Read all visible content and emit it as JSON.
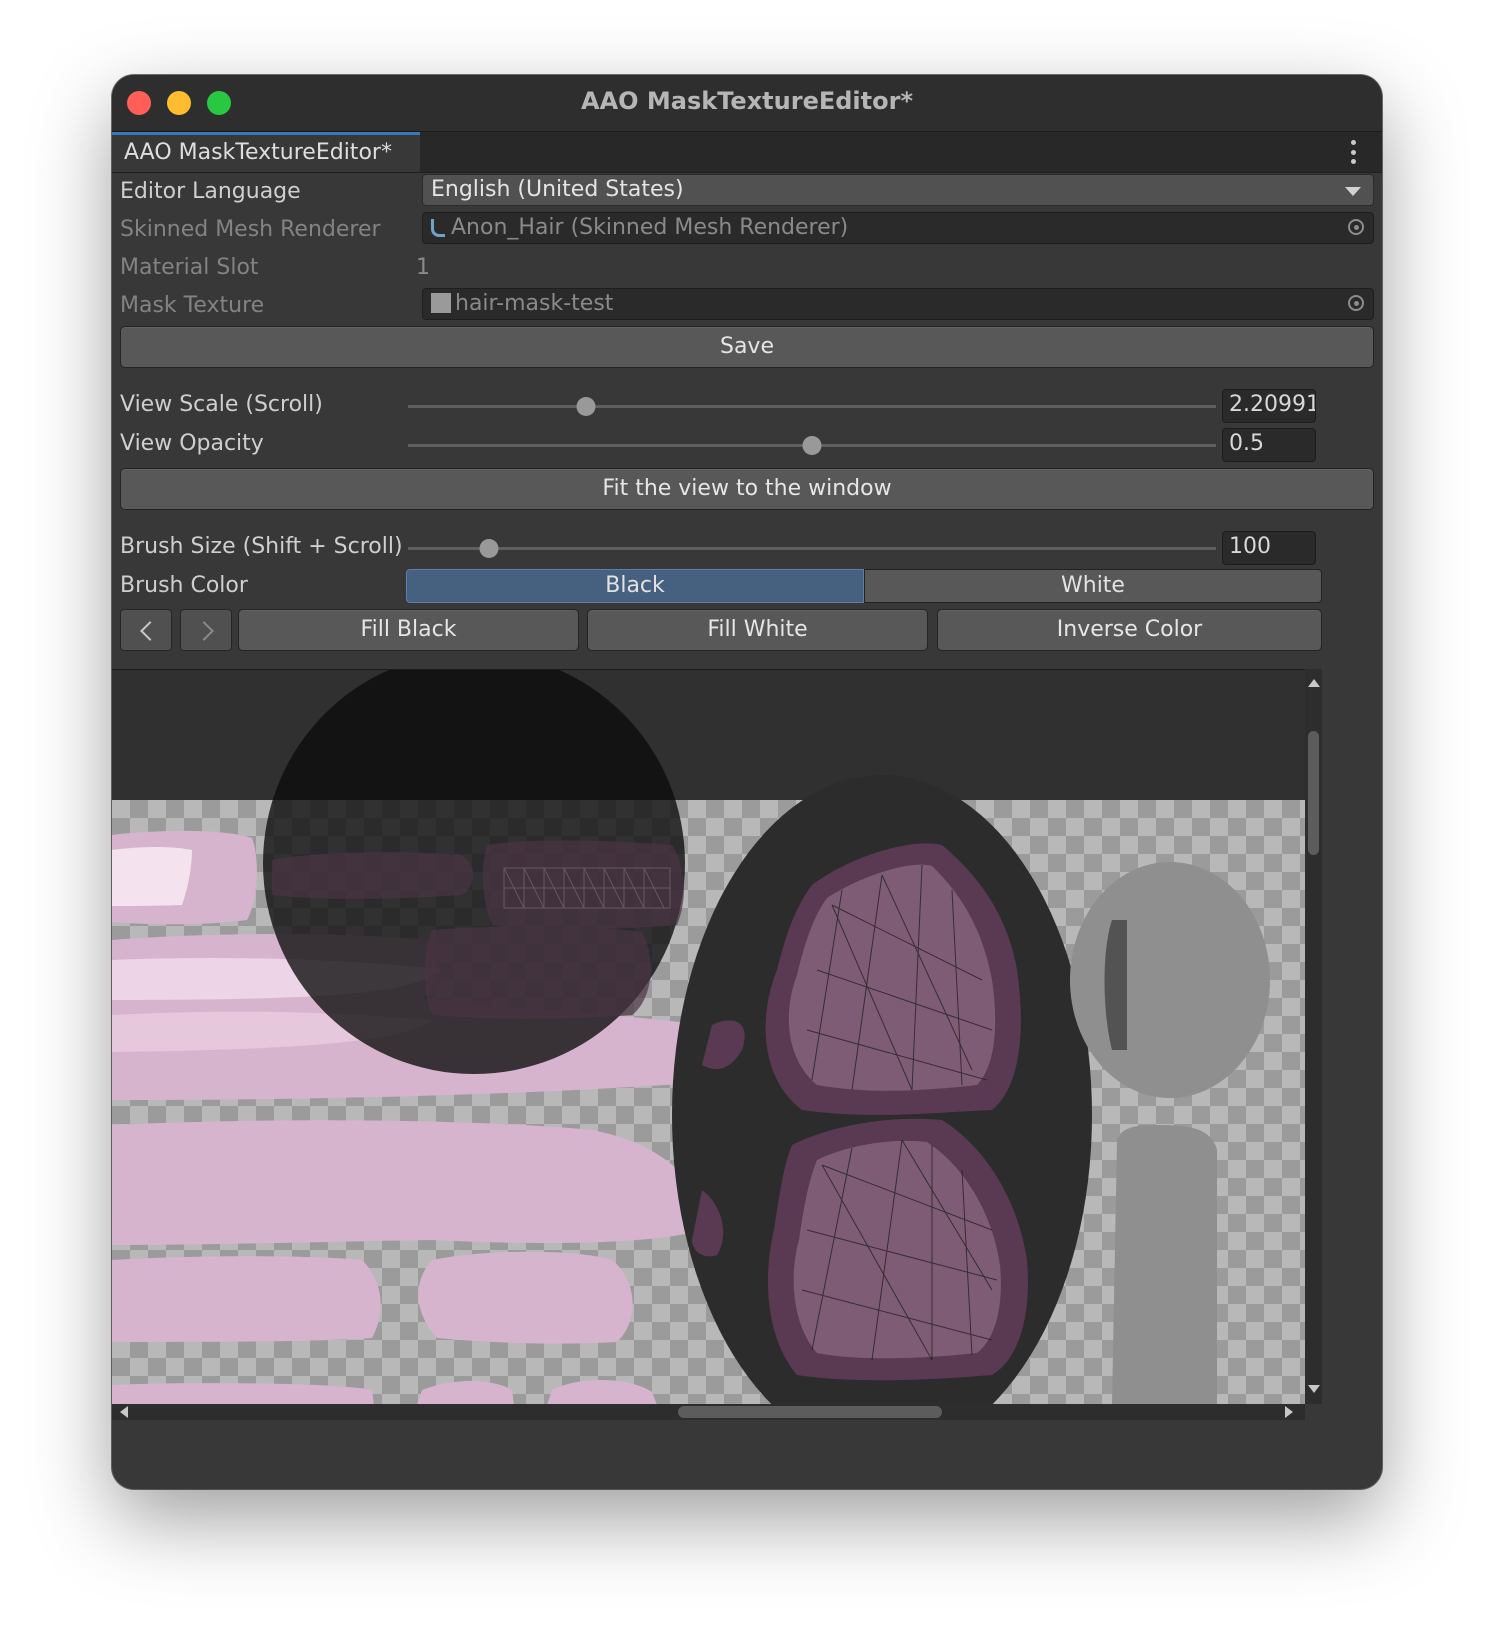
{
  "window": {
    "title": "AAO MaskTextureEditor*",
    "tab_label": "AAO MaskTextureEditor*"
  },
  "fields": {
    "editor_language": {
      "label": "Editor Language",
      "value": "English (United States)"
    },
    "skinned_mesh_renderer": {
      "label": "Skinned Mesh Renderer",
      "value": "Anon_Hair (Skinned Mesh Renderer)"
    },
    "material_slot": {
      "label": "Material Slot",
      "value": "1"
    },
    "mask_texture": {
      "label": "Mask Texture",
      "value": "hair-mask-test"
    }
  },
  "buttons": {
    "save": "Save",
    "fit_view": "Fit the view to the window",
    "fill_black": "Fill Black",
    "fill_white": "Fill White",
    "inverse_color": "Inverse Color"
  },
  "sliders": {
    "view_scale": {
      "label": "View Scale (Scroll)",
      "value": "2.20991",
      "fraction": 0.22
    },
    "view_opacity": {
      "label": "View Opacity",
      "value": "0.5",
      "fraction": 0.5
    },
    "brush_size": {
      "label": "Brush Size (Shift + Scroll)",
      "value": "100",
      "fraction": 0.1
    }
  },
  "brush_color": {
    "label": "Brush Color",
    "options": [
      "Black",
      "White"
    ],
    "selected": "Black"
  },
  "colors": {
    "window_bg": "#383838",
    "selected_segment": "#46607f",
    "tab_accent": "#3a79bb",
    "uv_island_pink": "#d6b4cd",
    "uv_island_purple": "#5a3a52"
  },
  "icons": [
    "mesh-renderer-icon",
    "texture-icon",
    "object-picker-icon",
    "dropdown-arrow-icon",
    "undo-icon",
    "redo-icon",
    "kebab-menu-icon"
  ]
}
